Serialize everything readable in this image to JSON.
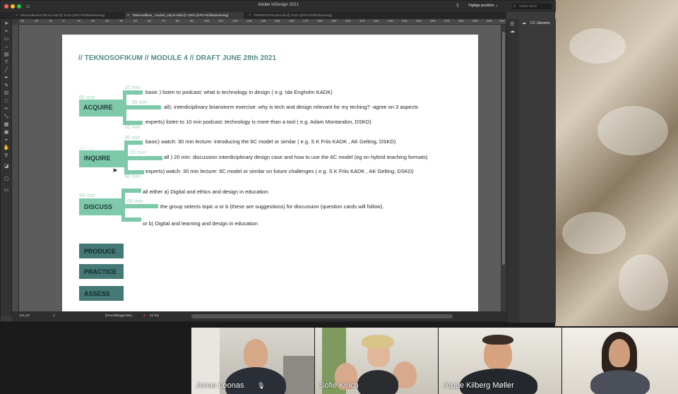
{
  "app": {
    "title": "Adobe InDesign 2021",
    "workspace": "Vigtige punkter",
    "search_placeholder": "Adobe Stock"
  },
  "tabs": [
    {
      "label": "teknosofikum23.06.21.indd @ 121% [GPU-forhåndsvisning]"
    },
    {
      "label": "*teknosofikum_ modul4_24juni.indd @ 125% [GPU-forhåndsvisning]"
    },
    {
      "label": "TEKNOSOFIKUM.indd @ 121% [GPU-forhåndsvisning]"
    }
  ],
  "ruler_top": [
    "30",
    "20",
    "10",
    "0",
    "10",
    "20",
    "30",
    "40",
    "50",
    "60",
    "70",
    "80",
    "90",
    "100",
    "110",
    "120",
    "130",
    "140",
    "150",
    "160",
    "170",
    "180",
    "190",
    "200",
    "210",
    "220",
    "230",
    "240",
    "250",
    "260",
    "270",
    "280",
    "290",
    "300",
    "310"
  ],
  "statusbar": {
    "zoom": "121,22",
    "page": "1",
    "style": "[Grundlæggende]...",
    "errors": "22 fejl"
  },
  "panels": {
    "cc_libraries": "CC Libraries"
  },
  "document": {
    "heading": "// TEKNOSOFIKUM // MODULE 4 // DRAFT JUNE 28th 2021",
    "acquire": {
      "label": "ACQUIRE",
      "total": "60 min",
      "items": [
        {
          "min": "10 min",
          "text": "basic ) listen to podcast: what is technology in design ( e.g. Ida Engholm KADK)"
        },
        {
          "min": "35 min",
          "text": "all): interdiciplinary brianstorm exercise: why is tech and design relevant for my teching? -agree on 3 aspects"
        },
        {
          "min": "10 min",
          "text": "experts) listen to 10 min podcast: technology is more than a tool ( e.g. Adam Montandon, DSKD)"
        }
      ]
    },
    "inquire": {
      "label": "INQUIRE",
      "total": "60 min",
      "items": [
        {
          "min": "30 min",
          "text": "basic) watch: 30 min lecture: introducing the 6C model or similar ( e.g. S K Friis KADK , AK Gelting, DSKD)"
        },
        {
          "min": "20 min",
          "text": "all ) 20 min: discussion interdiciplinary design case and how to use the 6C model (eg on hybrid teaching formats)"
        },
        {
          "min": "30 min",
          "text": "experts) watch: 30 min lecture: 6C model or similar on future challenges ( e.g. S K Friis KADK , AK Gelting, DSKD)"
        }
      ]
    },
    "discuss": {
      "label": "DISCUSS",
      "total": "60 min",
      "items": [
        {
          "text": "all either a) Digital and ethics and design in education"
        },
        {
          "min": "60 min",
          "text": "the group selects topic a or b (these are suggestions) for discussion (question cards will follow)."
        },
        {
          "text": "or b) Digital and learning and design in education"
        }
      ]
    },
    "stages": [
      "PRODUCE",
      "PRACTICE",
      "ASSESS"
    ]
  },
  "participants": [
    {
      "name": "Jonas Leonas"
    },
    {
      "name": "Sofie Kinch"
    },
    {
      "name": "Jeppe Kilberg Møller"
    },
    {
      "name": ""
    }
  ],
  "colors": {
    "accent_green": "#7ec9a9",
    "dark_teal": "#447975",
    "heading": "#4f8a86"
  }
}
